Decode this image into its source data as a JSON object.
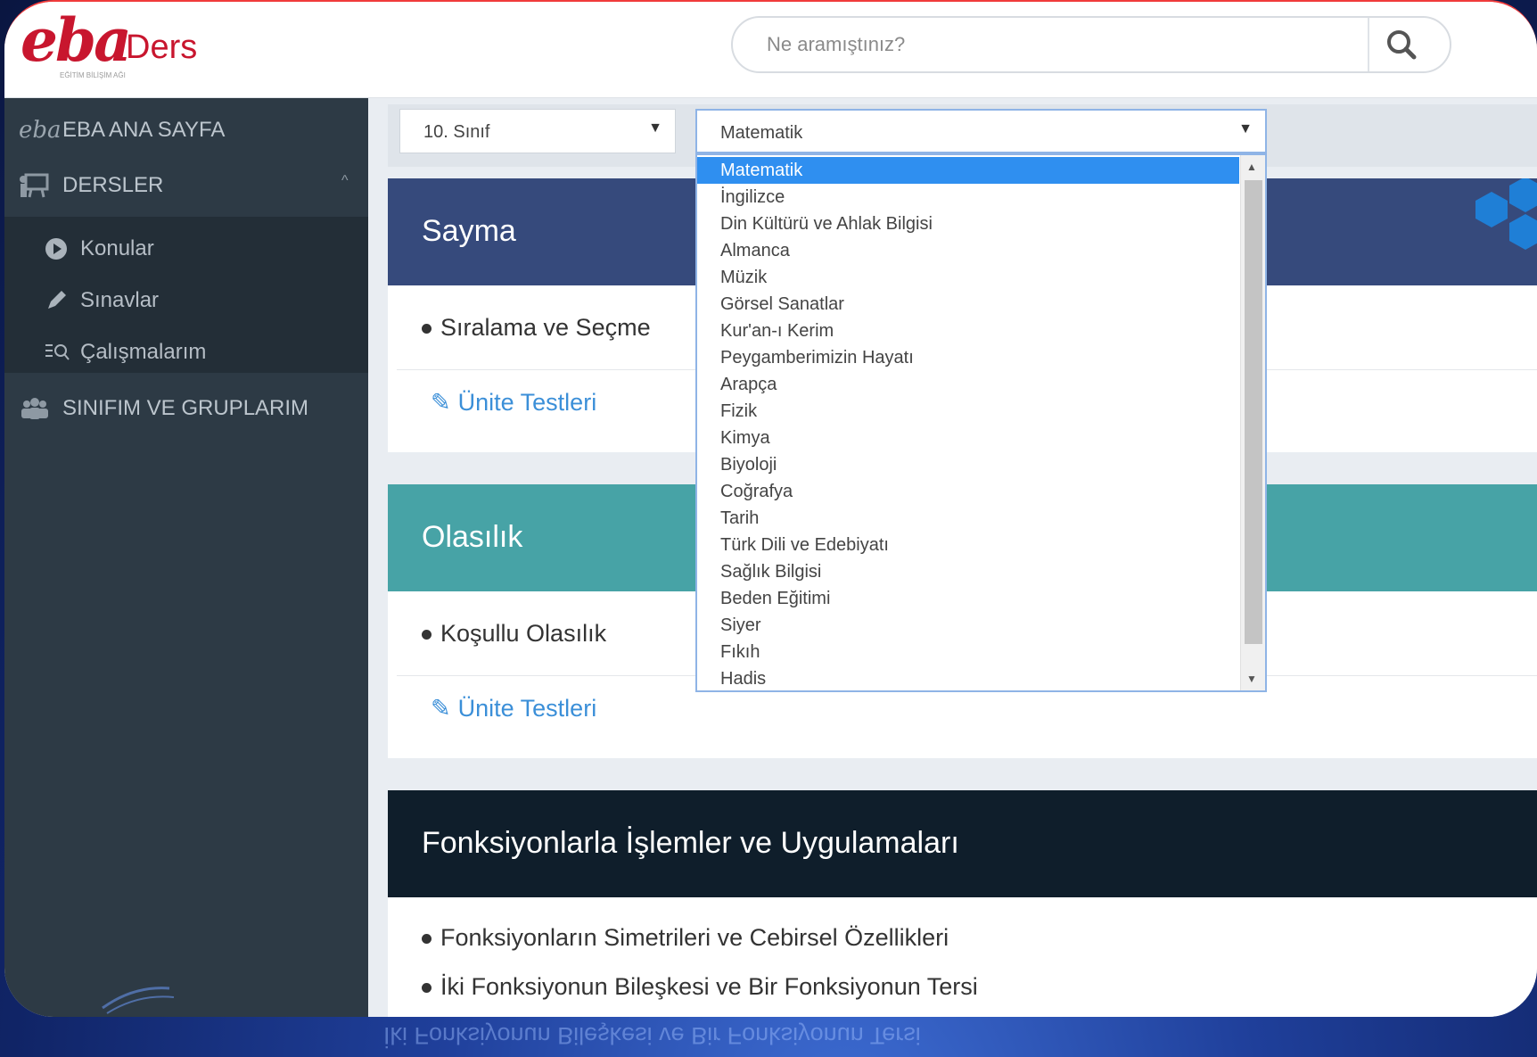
{
  "header": {
    "logo_brand": "eba",
    "logo_product": "Ders",
    "logo_tagline": "EĞİTİM BİLİŞİM AĞI",
    "search_placeholder": "Ne aramıştınız?",
    "search_icon": "magnifier-icon"
  },
  "sidebar": {
    "items": [
      {
        "label": "EBA ANA SAYFA",
        "icon": "eba-logo-icon"
      },
      {
        "label": "DERSLER",
        "icon": "presentation-board-icon"
      },
      {
        "label": "SINIFIM VE GRUPLARIM",
        "icon": "group-people-icon"
      }
    ],
    "sub_items": [
      {
        "label": "Konular",
        "icon": "play-circle-icon"
      },
      {
        "label": "Sınavlar",
        "icon": "pencil-icon"
      },
      {
        "label": "Çalışmalarım",
        "icon": "list-search-icon"
      }
    ]
  },
  "filters": {
    "grade_value": "10. Sınıf",
    "subject_value": "Matematik"
  },
  "subject_dropdown": {
    "selected": "Matematik",
    "options": [
      "Matematik",
      "İngilizce",
      "Din Kültürü ve Ahlak Bilgisi",
      "Almanca",
      "Müzik",
      "Görsel Sanatlar",
      "Kur'an-ı Kerim",
      "Peygamberimizin Hayatı",
      "Arapça",
      "Fizik",
      "Kimya",
      "Biyoloji",
      "Coğrafya",
      "Tarih",
      "Türk Dili ve Edebiyatı",
      "Sağlık Bilgisi",
      "Beden Eğitimi",
      "Siyer",
      "Fıkıh",
      "Hadis"
    ]
  },
  "units": [
    {
      "title": "Sayma",
      "color": "#364a7c",
      "topics": [
        "Sıralama ve Seçme"
      ],
      "link": "Ünite Testleri"
    },
    {
      "title": "Olasılık",
      "color": "#47a3a6",
      "topics": [
        "Koşullu Olasılık"
      ],
      "link": "Ünite Testleri"
    },
    {
      "title": "Fonksiyonlarla İşlemler ve Uygulamaları",
      "color": "#0f1e2b",
      "topics": [
        "Fonksiyonların Simetrileri ve Cebirsel Özellikleri",
        "İki Fonksiyonun Bileşkesi ve Bir Fonksiyonun Tersi"
      ]
    }
  ],
  "colors": {
    "brand": "#c8162e",
    "sidebar": "#2d3a45",
    "link": "#3b8fd8",
    "dropdown_selected": "#2f8ff0"
  }
}
